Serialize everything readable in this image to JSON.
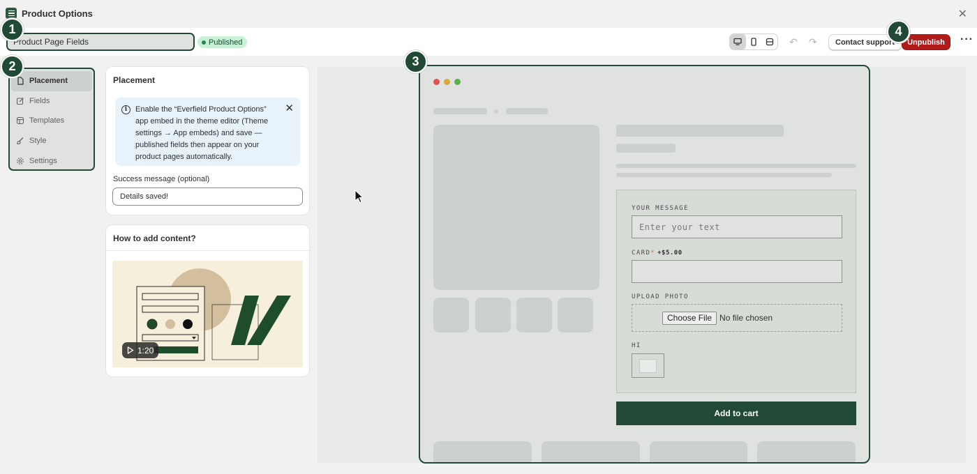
{
  "window": {
    "title": "Product Options"
  },
  "topbar": {
    "name_value": "Product Page Fields",
    "status_badge": "Published",
    "contact_support": "Contact support",
    "unpublish": "Unpublish"
  },
  "nav": {
    "items": [
      {
        "label": "Placement",
        "icon": "page-icon",
        "active": true
      },
      {
        "label": "Fields",
        "icon": "edit-icon"
      },
      {
        "label": "Templates",
        "icon": "template-icon"
      },
      {
        "label": "Style",
        "icon": "brush-icon"
      },
      {
        "label": "Settings",
        "icon": "gear-icon"
      }
    ]
  },
  "placement": {
    "heading": "Placement",
    "info_text": "Enable the “Everfield Product Options” app embed in the theme editor (Theme settings → App embeds) and save — published fields then appear on your product pages automatically.",
    "success_label": "Success message (optional)",
    "success_value": "Details saved!"
  },
  "howto": {
    "heading": "How to add content?",
    "video_duration": "1:20"
  },
  "preview": {
    "your_message_label": "YOUR MESSAGE",
    "your_message_placeholder": "Enter your text",
    "card_label": "CARD",
    "card_required": "*",
    "card_price": "+$5.00",
    "upload_label": "UPLOAD PHOTO",
    "choose_file": "Choose File",
    "no_file": "No file chosen",
    "hi_label": "HI",
    "add_to_cart": "Add to cart"
  },
  "markers": [
    "1",
    "2",
    "3",
    "4"
  ],
  "colors": {
    "brand_green": "#204a35",
    "unpublish_red": "#b31b1b",
    "published_bg": "#c9f0d5",
    "info_bg": "#e8f2fb"
  }
}
